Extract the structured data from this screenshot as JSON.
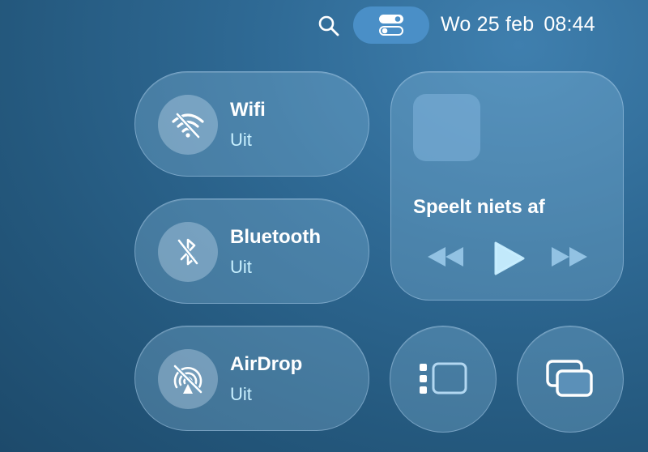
{
  "menubar": {
    "date": "Wo 25 feb",
    "time": "08:44"
  },
  "controls": {
    "wifi": {
      "label": "Wifi",
      "status": "Uit"
    },
    "bluetooth": {
      "label": "Bluetooth",
      "status": "Uit"
    },
    "airdrop": {
      "label": "AirDrop",
      "status": "Uit"
    }
  },
  "media": {
    "now_playing": "Speelt niets af"
  },
  "icons": {
    "search": "search-icon",
    "control_center": "control-center-icon",
    "wifi": "wifi-off-icon",
    "bluetooth": "bluetooth-off-icon",
    "airdrop": "airdrop-off-icon",
    "prev": "rewind-icon",
    "play": "play-icon",
    "next": "fast-forward-icon",
    "stage_manager": "stage-manager-icon",
    "screen_mirroring": "screen-mirroring-icon"
  },
  "colors": {
    "accent": "#4a8fc7",
    "status_text": "#c8f0ff"
  }
}
